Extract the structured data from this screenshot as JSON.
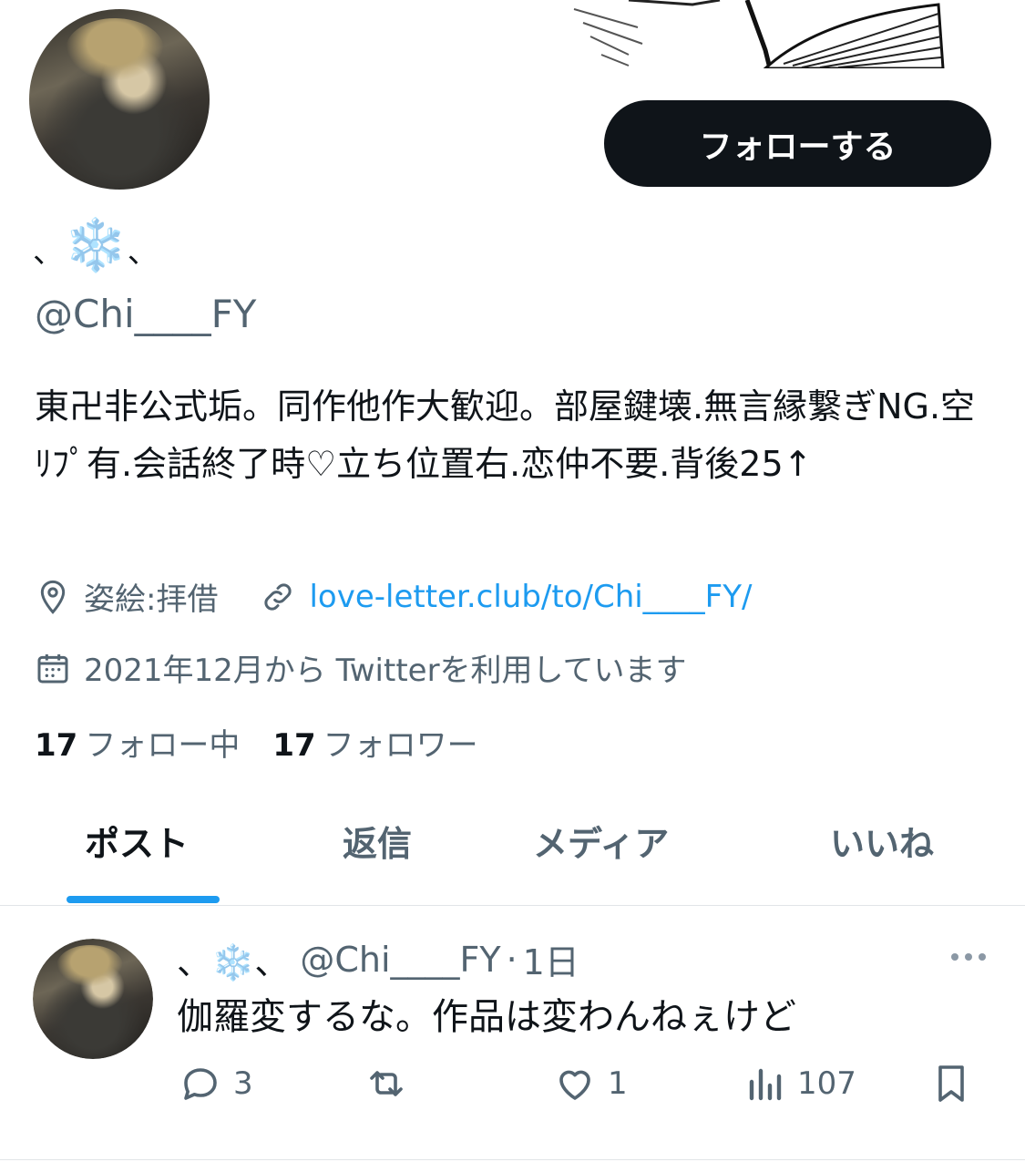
{
  "profile": {
    "display_name": "❄️",
    "display_name_prefix": "、",
    "display_name_suffix": "、",
    "handle": "@Chi____FY",
    "follow_label": "フォローする",
    "bio": "東卍非公式垢。同作他作大歓迎。部屋鍵壊.無言縁繋ぎNG.空ﾘﾌﾟ有.会話終了時♡立ち位置右.恋仲不要.背後25↑",
    "location": "姿絵:拝借",
    "website": "love-letter.club/to/Chi____FY/",
    "joined": "2021年12月から Twitterを利用しています",
    "following_count": "17",
    "following_label": "フォロー中",
    "followers_count": "17",
    "followers_label": "フォロワー"
  },
  "tabs": [
    {
      "label": "ポスト",
      "active": true
    },
    {
      "label": "返信",
      "active": false
    },
    {
      "label": "メディア",
      "active": false
    },
    {
      "label": "いいね",
      "active": false
    }
  ],
  "post": {
    "name": "、❄️、",
    "handle": "@Chi____FY",
    "separator": "·",
    "time": "1日",
    "text": "伽羅変するな。作品は変わんねぇけど",
    "replies": "3",
    "likes": "1",
    "views": "107"
  },
  "colors": {
    "accent": "#1d9bf0",
    "text_primary": "#0f1419",
    "text_secondary": "#536471",
    "button_bg": "#0f1419"
  },
  "icons": [
    "location-icon",
    "link-icon",
    "calendar-icon",
    "reply-icon",
    "repost-icon",
    "like-icon",
    "views-icon",
    "bookmark-icon",
    "more-icon"
  ]
}
